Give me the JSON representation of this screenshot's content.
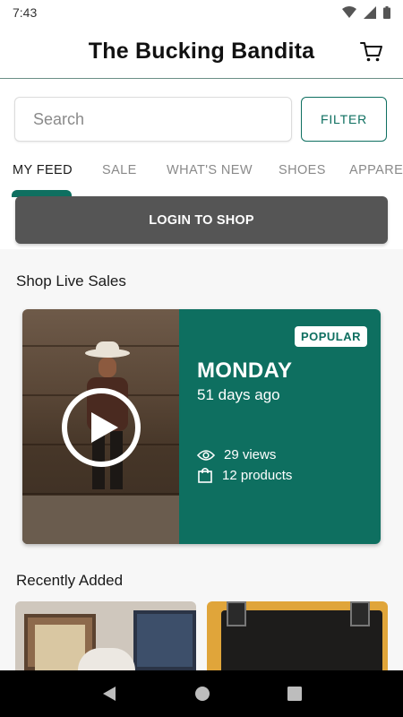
{
  "status_bar": {
    "time": "7:43"
  },
  "header": {
    "title": "The Bucking Bandita",
    "cart_icon": "shopping-cart-icon"
  },
  "search": {
    "placeholder": "Search",
    "value": "",
    "filter_label": "FILTER"
  },
  "tabs": [
    {
      "label": "MY FEED",
      "active": true
    },
    {
      "label": "SALE",
      "active": false
    },
    {
      "label": "WHAT'S NEW",
      "active": false
    },
    {
      "label": "SHOES",
      "active": false
    },
    {
      "label": "APPAREL",
      "active": false
    }
  ],
  "login_button": {
    "label": "LOGIN TO SHOP"
  },
  "live_sales": {
    "section_title": "Shop Live Sales",
    "card": {
      "badge": "POPULAR",
      "title": "MONDAY",
      "time_ago": "51 days ago",
      "views": "29 views",
      "products": "12 products",
      "play_icon": "play-icon"
    }
  },
  "recently_added": {
    "section_title": "Recently Added"
  },
  "colors": {
    "accent": "#0e6f60",
    "login_button": "#555555",
    "nav_bar": "#000000"
  }
}
